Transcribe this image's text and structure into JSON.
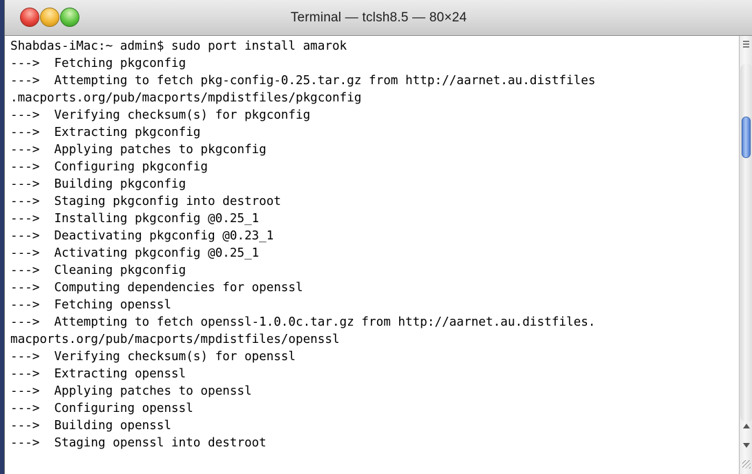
{
  "window": {
    "title": "Terminal — tclsh8.5 — 80×24",
    "colors": {
      "close": "#e8453c",
      "minimize": "#f2b632",
      "zoom": "#5fc541",
      "scroll_thumb": "#5a86d8",
      "text": "#000000",
      "background": "#ffffff"
    }
  },
  "terminal": {
    "lines": [
      "Shabdas-iMac:~ admin$ sudo port install amarok",
      "--->  Fetching pkgconfig",
      "--->  Attempting to fetch pkg-config-0.25.tar.gz from http://aarnet.au.distfiles",
      ".macports.org/pub/macports/mpdistfiles/pkgconfig",
      "--->  Verifying checksum(s) for pkgconfig",
      "--->  Extracting pkgconfig",
      "--->  Applying patches to pkgconfig",
      "--->  Configuring pkgconfig",
      "--->  Building pkgconfig",
      "--->  Staging pkgconfig into destroot",
      "--->  Installing pkgconfig @0.25_1",
      "--->  Deactivating pkgconfig @0.23_1",
      "--->  Activating pkgconfig @0.25_1",
      "--->  Cleaning pkgconfig",
      "--->  Computing dependencies for openssl",
      "--->  Fetching openssl",
      "--->  Attempting to fetch openssl-1.0.0c.tar.gz from http://aarnet.au.distfiles.",
      "macports.org/pub/macports/mpdistfiles/openssl",
      "--->  Verifying checksum(s) for openssl",
      "--->  Extracting openssl",
      "--->  Applying patches to openssl",
      "--->  Configuring openssl",
      "--->  Building openssl",
      "--->  Staging openssl into destroot"
    ]
  },
  "scrollbar": {
    "icons": [
      "scroll-grip-icon",
      "scroll-up-arrow-icon",
      "scroll-down-arrow-icon",
      "resize-grip-icon"
    ]
  }
}
